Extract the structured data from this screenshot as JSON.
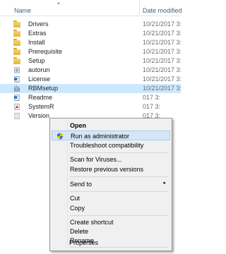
{
  "header": {
    "name_label": "Name",
    "date_label": "Date modified"
  },
  "files": [
    {
      "name": "Drivers",
      "date": "10/21/2017 3:",
      "icon": "folder-icon"
    },
    {
      "name": "Extras",
      "date": "10/21/2017 3:",
      "icon": "folder-icon"
    },
    {
      "name": "Install",
      "date": "10/21/2017 3:",
      "icon": "folder-icon"
    },
    {
      "name": "Prerequisite",
      "date": "10/21/2017 3:",
      "icon": "folder-icon"
    },
    {
      "name": "Setup",
      "date": "10/21/2017 3:",
      "icon": "folder-icon"
    },
    {
      "name": "autorun",
      "date": "10/21/2017 3:",
      "icon": "setup-information-icon"
    },
    {
      "name": "License",
      "date": "10/21/2017 3:",
      "icon": "rtf-document-icon"
    },
    {
      "name": "RBMsetup",
      "date": "10/21/2017 3:",
      "icon": "installer-icon"
    },
    {
      "name": "Readme",
      "date": "017 3:",
      "icon": "rtf-document-icon"
    },
    {
      "name": "SystemR",
      "date": "017 3:",
      "icon": "pdf-icon"
    },
    {
      "name": "Version",
      "date": "017 3:",
      "icon": "text-document-icon"
    }
  ],
  "context_menu": {
    "open": "Open",
    "run_as_admin": "Run as administrator",
    "troubleshoot": "Troubleshoot compatibility",
    "scan": "Scan for Viruses...",
    "restore": "Restore previous versions",
    "send_to": "Send to",
    "send_to_arrow": "▸",
    "cut": "Cut",
    "copy": "Copy",
    "create_shortcut": "Create shortcut",
    "delete": "Delete",
    "rename": "Rename",
    "properties": "Properties"
  },
  "colors": {
    "selection": "#cce8ff",
    "menu_background": "#f0f0f0",
    "menu_highlight": "#d5e6f6"
  }
}
